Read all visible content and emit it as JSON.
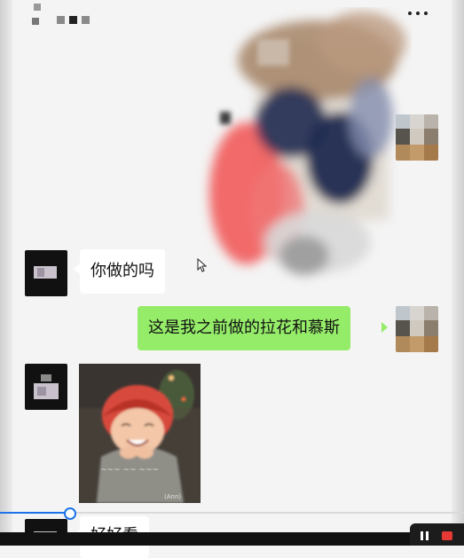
{
  "chat": {
    "messages": [
      {
        "sender": "other",
        "type": "text",
        "text": "你做的吗"
      },
      {
        "sender": "me",
        "type": "text",
        "text": "这是我之前做的拉花和慕斯"
      },
      {
        "sender": "other",
        "type": "image",
        "caption": "",
        "watermark": "(Ann)"
      },
      {
        "sender": "other",
        "type": "text",
        "text": "好好看"
      }
    ]
  },
  "icons": {
    "more": "more-dots-icon",
    "pause": "pause-icon",
    "stop": "stop-icon"
  },
  "video": {
    "progress_fraction": 0.15
  },
  "colors": {
    "incoming_bubble": "#ffffff",
    "outgoing_bubble": "#95ec69",
    "progress": "#1a73e8",
    "record_stop": "#e53935"
  }
}
